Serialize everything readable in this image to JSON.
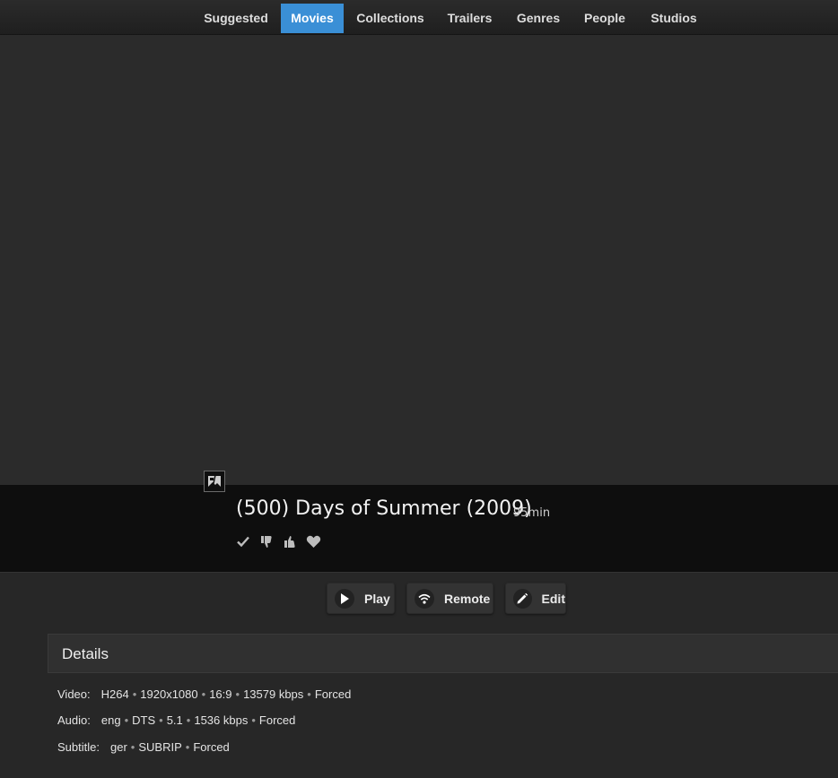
{
  "nav": {
    "tabs": [
      {
        "label": "Suggested"
      },
      {
        "label": "Movies",
        "active": true
      },
      {
        "label": "Collections"
      },
      {
        "label": "Trailers"
      },
      {
        "label": "Genres"
      },
      {
        "label": "People"
      },
      {
        "label": "Studios"
      }
    ]
  },
  "movie": {
    "title": "(500) Days of Summer (2009)",
    "runtime": "95min"
  },
  "actions": {
    "play": "Play",
    "remote": "Remote",
    "edit": "Edit"
  },
  "details": {
    "header": "Details",
    "video": {
      "label": "Video:",
      "parts": [
        "H264",
        "1920x1080",
        "16:9",
        "13579 kbps",
        "Forced"
      ]
    },
    "audio": {
      "label": "Audio:",
      "parts": [
        "eng",
        "DTS",
        "5.1",
        "1536 kbps",
        "Forced"
      ]
    },
    "subtitle": {
      "label": "Subtitle:",
      "parts": [
        "ger",
        "SUBRIP",
        "Forced"
      ]
    }
  },
  "colors": {
    "accent": "#3a8fd6",
    "background": "#272727",
    "titleband": "#0e0e0e"
  }
}
